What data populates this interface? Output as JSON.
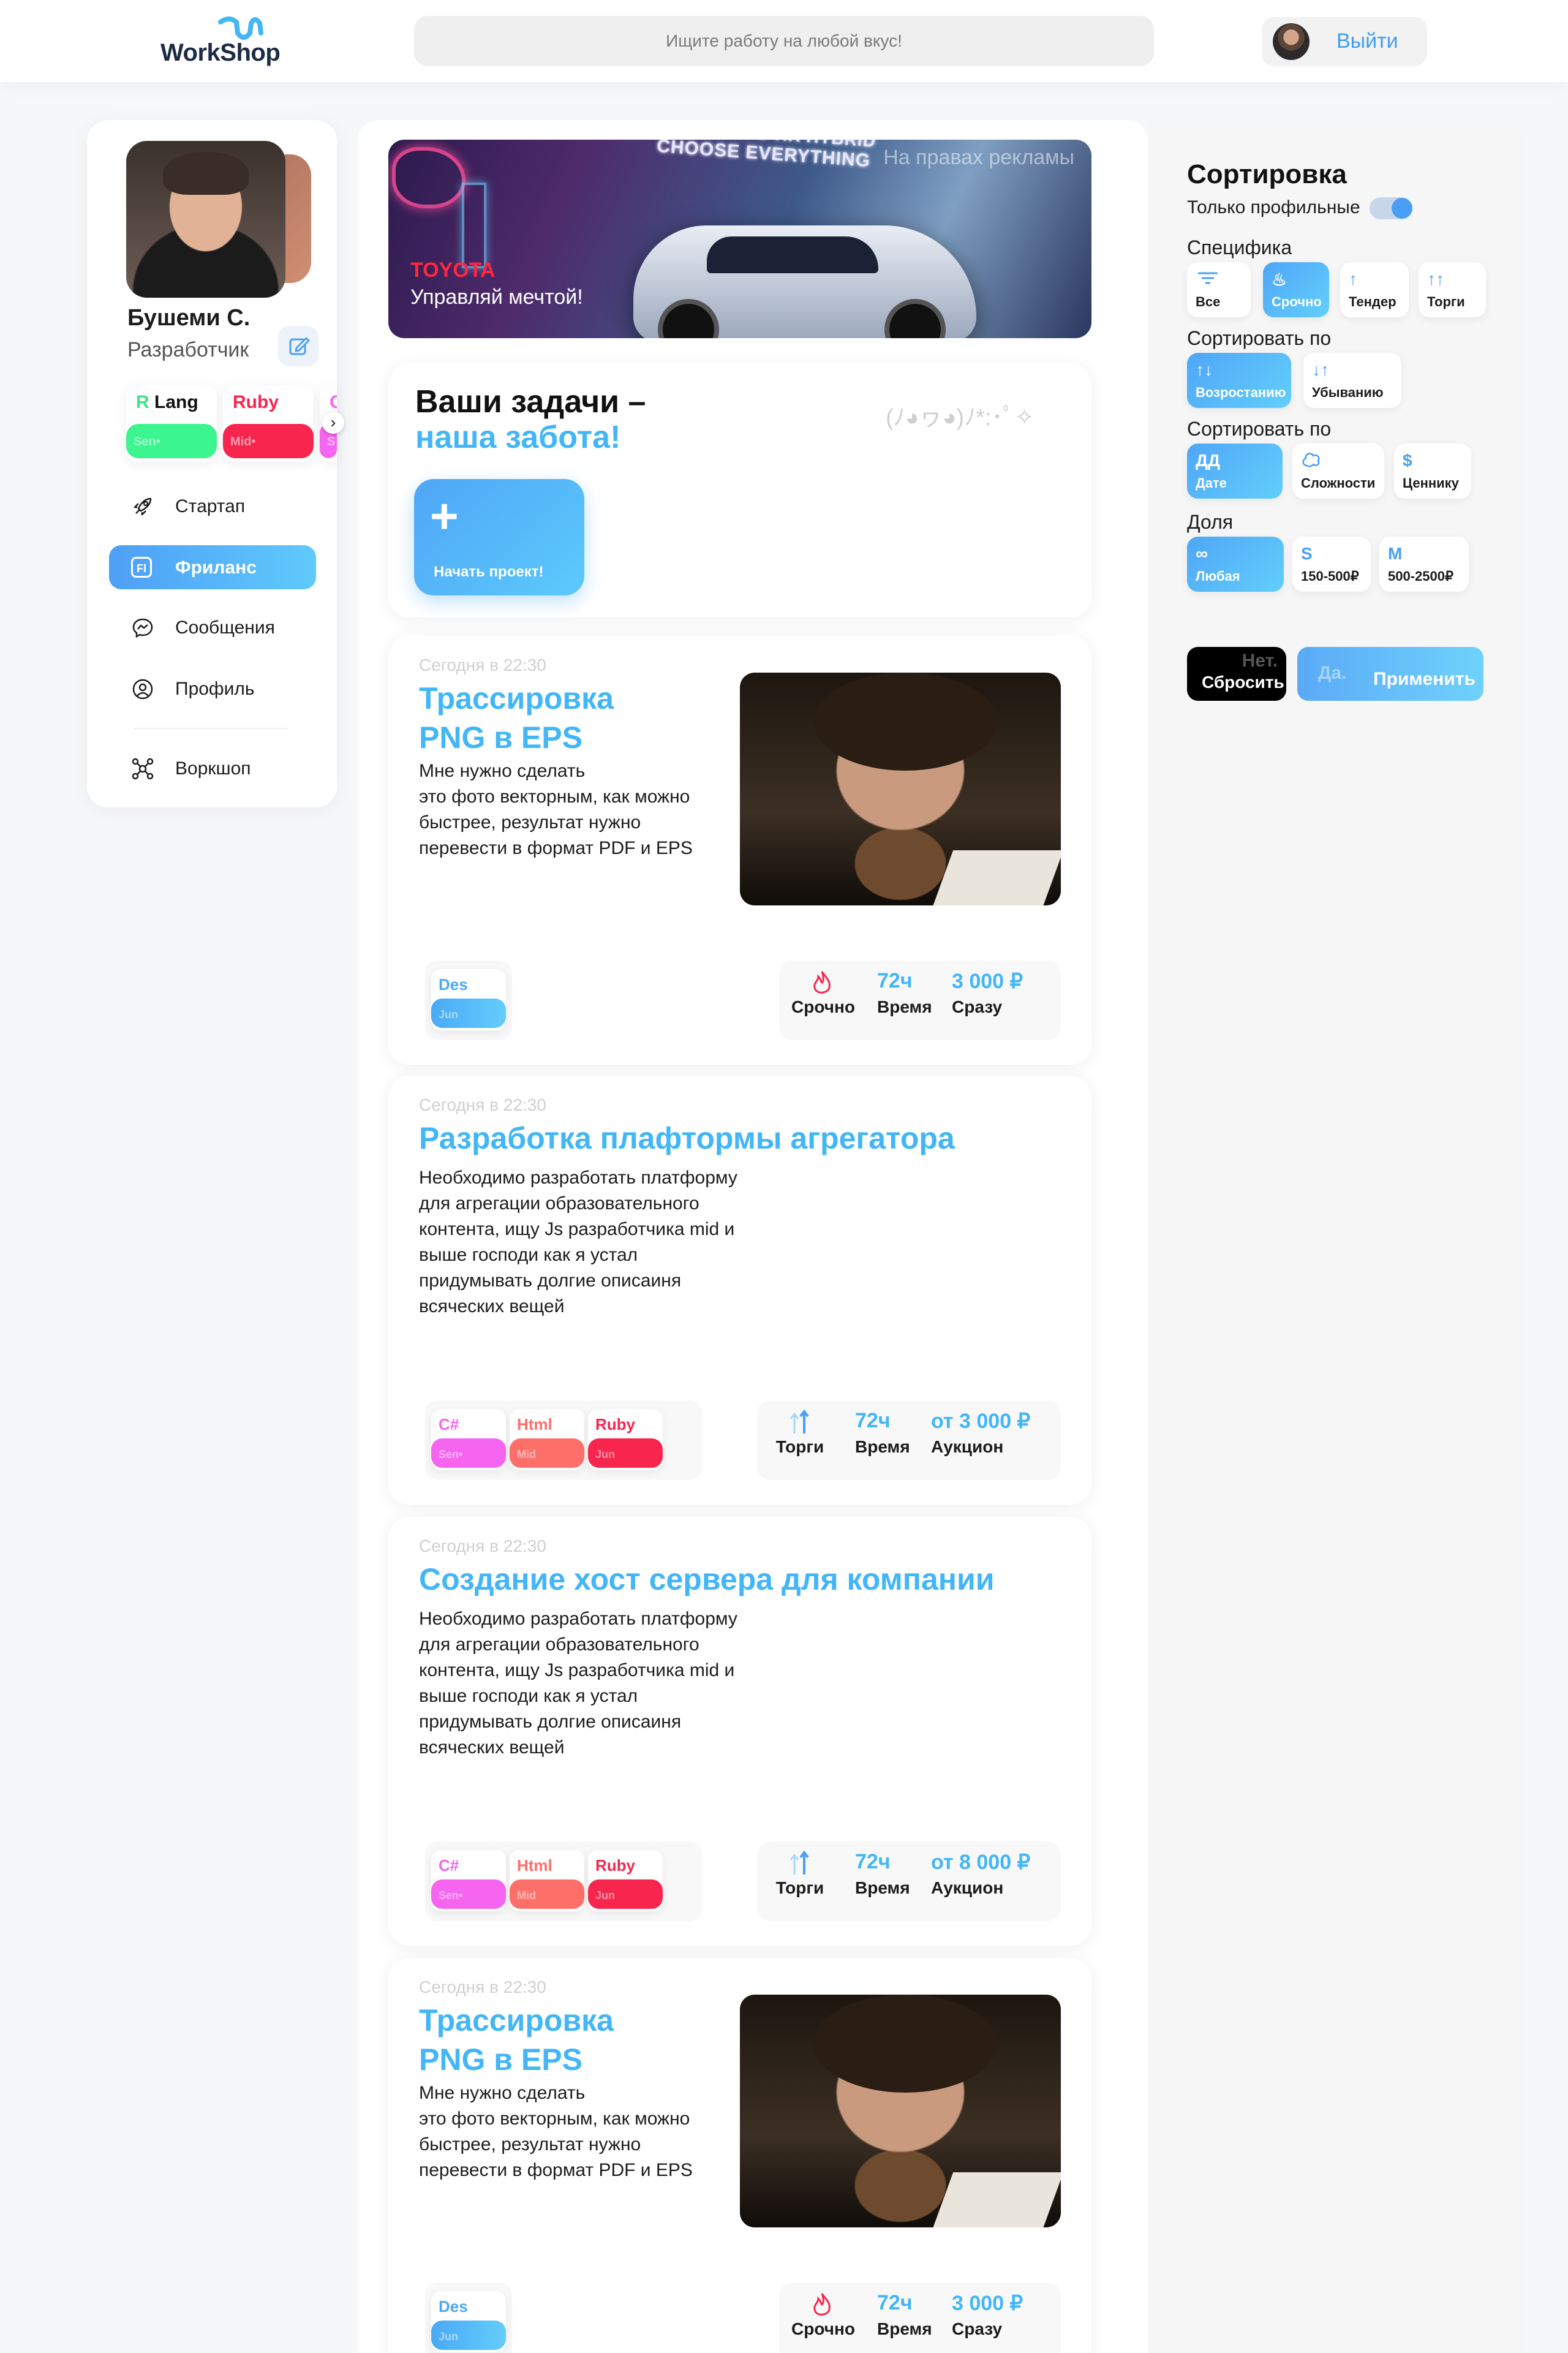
{
  "header": {
    "logo_text": "WorkShop",
    "search_placeholder": "Ищите работу на любой вкус!",
    "logout_label": "Выйти"
  },
  "profile": {
    "name": "Бушеми С.",
    "role": "Разработчик",
    "skills": [
      {
        "prefix": "R",
        "name": "Lang",
        "level": "Sen•"
      },
      {
        "name": "Ruby",
        "level": "Mid•"
      },
      {
        "name": "C",
        "level": "S"
      }
    ]
  },
  "nav": {
    "items": [
      {
        "label": "Стартап",
        "icon": "rocket-icon"
      },
      {
        "label": "Фриланс",
        "icon": "fl-badge-icon",
        "badge": "Fl",
        "active": true
      },
      {
        "label": "Сообщения",
        "icon": "messenger-icon"
      },
      {
        "label": "Профиль",
        "icon": "user-circle-icon"
      },
      {
        "label": "Воркшоп",
        "icon": "network-icon"
      }
    ]
  },
  "ad": {
    "top_text": "CHOOSE EVERYTHING",
    "hybrid_text": "C-HR HYBRID",
    "notice": "На правах рекламы",
    "brand": "TOYOTA",
    "slogan": "Управляй мечтой!"
  },
  "tasks_card": {
    "title_line1": "Ваши задачи –",
    "title_line2": "наша забота!",
    "kaomoji": "(ﾉ◕ヮ◕)ﾉ*:･ﾟ✧",
    "start_button_label": "Начать проект!"
  },
  "jobs": [
    {
      "date": "Сегодня в 22:30",
      "title": "Трассировка\nPNG в EPS",
      "description": "Мне нужно сделать\nэто фото векторным, как можно\nбыстрее, результат нужно\nперевести в формат PDF и EPS",
      "has_image": true,
      "tags": [
        {
          "name": "Des",
          "level": "Jun",
          "color": "#4aa9f6"
        }
      ],
      "stats": [
        {
          "icon": "fire-icon",
          "value": "",
          "label": "Срочно"
        },
        {
          "value": "72ч",
          "label": "Время"
        },
        {
          "value": "3 000 ₽",
          "label": "Сразу"
        }
      ]
    },
    {
      "date": "Сегодня в 22:30",
      "title": "Разработка плафтормы агрегатора",
      "description": "Необходимо разработать платформу\nдля агрегации образовательного\nконтента, ищу Js разработчика mid и\nвыше господи как я устал\nпридумывать долгие описаиня\nвсяческих вещей",
      "has_image": false,
      "tags": [
        {
          "name": "C#",
          "level": "Sen•",
          "color": "#f665f0"
        },
        {
          "name": "Html",
          "level": "Mid",
          "color": "#ff6f6a"
        },
        {
          "name": "Ruby",
          "level": "Jun",
          "color": "#f8254e"
        }
      ],
      "stats": [
        {
          "icon": "arrows-icon",
          "value": "",
          "label": "Торги"
        },
        {
          "value": "72ч",
          "label": "Время"
        },
        {
          "value": "от 3 000 ₽",
          "label": "Аукцион"
        }
      ]
    },
    {
      "date": "Сегодня в 22:30",
      "title": "Создание хост сервера для компании",
      "description": "Необходимо разработать платформу\nдля агрегации образовательного\nконтента, ищу Js разработчика mid и\nвыше господи как я устал\nпридумывать долгие описаиня\nвсяческих вещей",
      "has_image": false,
      "tags": [
        {
          "name": "C#",
          "level": "Sen•",
          "color": "#f665f0"
        },
        {
          "name": "Html",
          "level": "Mid",
          "color": "#ff6f6a"
        },
        {
          "name": "Ruby",
          "level": "Jun",
          "color": "#f8254e"
        }
      ],
      "stats": [
        {
          "icon": "arrows-icon",
          "value": "",
          "label": "Торги"
        },
        {
          "value": "72ч",
          "label": "Время"
        },
        {
          "value": "от 8 000 ₽",
          "label": "Аукцион"
        }
      ]
    },
    {
      "date": "Сегодня в 22:30",
      "title": "Трассировка\nPNG в EPS",
      "description": "Мне нужно сделать\nэто фото векторным, как можно\nбыстрее, результат нужно\nперевести в формат PDF и EPS",
      "has_image": true,
      "tags": [
        {
          "name": "Des",
          "level": "Jun",
          "color": "#4aa9f6"
        }
      ],
      "stats": [
        {
          "icon": "fire-icon",
          "value": "",
          "label": "Срочно"
        },
        {
          "value": "72ч",
          "label": "Время"
        },
        {
          "value": "3 000 ₽",
          "label": "Сразу"
        }
      ]
    }
  ],
  "sort": {
    "title": "Сортировка",
    "only_profile_label": "Только профильные",
    "only_profile_on": true,
    "groups": [
      {
        "label": "Специфика",
        "options": [
          {
            "label": "Все",
            "icon": "filter-icon"
          },
          {
            "label": "Срочно",
            "icon": "fire-icon",
            "selected": true
          },
          {
            "label": "Тендер",
            "icon": "arrow-up-icon"
          },
          {
            "label": "Торги",
            "icon": "double-arrow-icon"
          }
        ]
      },
      {
        "label": "Сортировать по",
        "options": [
          {
            "label": "Возростанию",
            "icon": "arrow-up-icon",
            "selected": true
          },
          {
            "label": "Убыванию",
            "icon": "arrow-down-icon"
          }
        ]
      },
      {
        "label": "Сортировать по",
        "options": [
          {
            "label": "Дате",
            "icon": "date-icon",
            "glyph": "ДД",
            "selected": true
          },
          {
            "label": "Сложности",
            "icon": "brain-icon"
          },
          {
            "label": "Ценнику",
            "icon": "dollar-icon",
            "glyph": "$"
          }
        ]
      },
      {
        "label": "Доля",
        "options": [
          {
            "label": "Любая",
            "icon": "infinity-icon",
            "glyph": "∞",
            "selected": true
          },
          {
            "label": "150-500₽",
            "glyph": "S"
          },
          {
            "label": "500-2500₽",
            "glyph": "M"
          }
        ]
      }
    ],
    "reset_label": "Сбросить",
    "reset_ghost": "Нет.",
    "apply_label": "Применить",
    "apply_ghost": "Да."
  },
  "colors": {
    "accent": "#43b6f7",
    "accent_dark": "#4a9ff5",
    "brand_red": "#ff2640"
  }
}
